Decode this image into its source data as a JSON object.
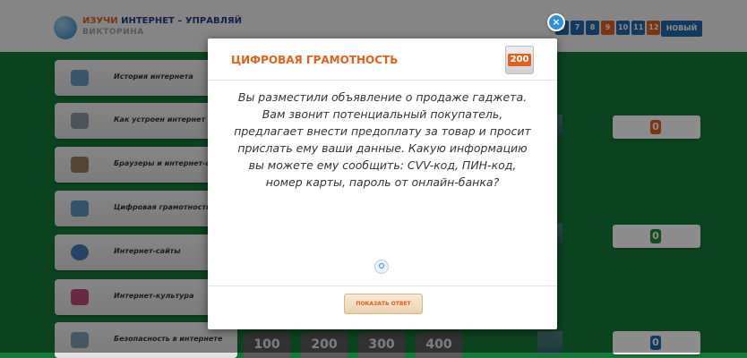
{
  "header": {
    "logo_title_orange": "ИЗУЧИ",
    "logo_title_blue": "ИНТЕРНЕТ – УПРАВЛЯЙ",
    "logo_subtitle": "ВИКТОРИНА",
    "rounds": [
      "6",
      "7",
      "8",
      "9",
      "10",
      "11",
      "12",
      "13"
    ],
    "new_button": "НОВЫЙ"
  },
  "categories": [
    {
      "label": "История интернета",
      "icon": "globe-icon"
    },
    {
      "label": "Как устроен интернет",
      "icon": "network-icon"
    },
    {
      "label": "Браузеры и интернет-сервисы",
      "icon": "browser-icon"
    },
    {
      "label": "Цифровая грамотность",
      "icon": "chat-icon"
    },
    {
      "label": "Интернет-сайты",
      "icon": "www-icon"
    },
    {
      "label": "Интернет-культура",
      "icon": "people-icon"
    },
    {
      "label": "Безопасность в интернете",
      "icon": "shield-icon"
    }
  ],
  "scores": [
    "0",
    "0",
    "0"
  ],
  "points": [
    "100",
    "200",
    "300",
    "400"
  ],
  "modal": {
    "title": "ЦИФРОВАЯ ГРАМОТНОСТЬ",
    "points": "200",
    "question": "Вы разместили объявление о продаже гаджета. Вам звонит потенциальный покупатель, предлагает внести предоплату за товар и просит прислать ему ваши данные. Какую информацию вы можете ему сообщить: CVV-код, ПИН-код, номер карты, пароль от онлайн-банка?",
    "show_answer_button": "ПОКАЗАТЬ ОТВЕТ",
    "close_symbol": "×"
  },
  "colors": {
    "accent_orange": "#e2611d",
    "background_green": "#147a3a",
    "round_blue": "#1f6ab0"
  }
}
